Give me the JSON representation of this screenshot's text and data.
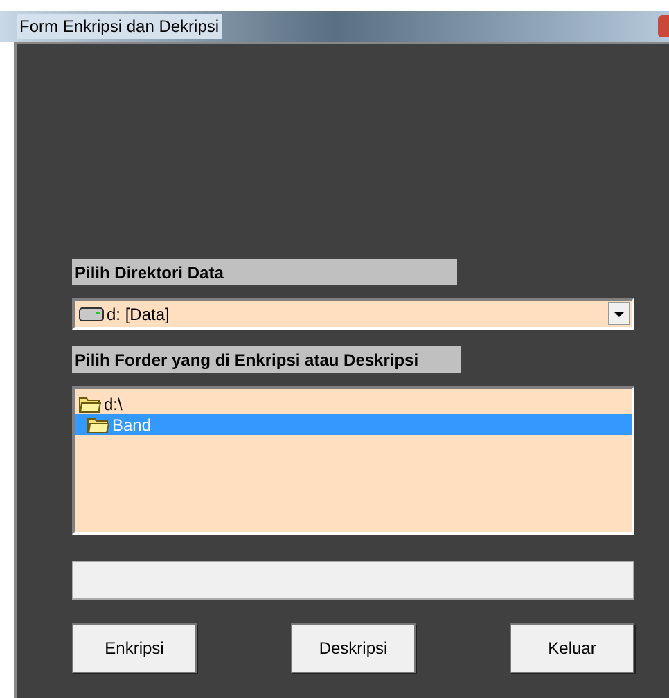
{
  "window": {
    "title": "Form Enkripsi dan Dekripsi"
  },
  "drive_label": "Pilih Direktori Data",
  "drive_combo": {
    "value": "d: [Data]"
  },
  "folder_label": "Pilih Forder yang di Enkripsi atau Deskripsi",
  "folders": [
    {
      "name": "d:\\",
      "selected": false,
      "children": [
        {
          "name": "Band",
          "selected": true
        }
      ]
    }
  ],
  "buttons": [
    "Enkripsi",
    "Deskripsi",
    "Keluar"
  ]
}
